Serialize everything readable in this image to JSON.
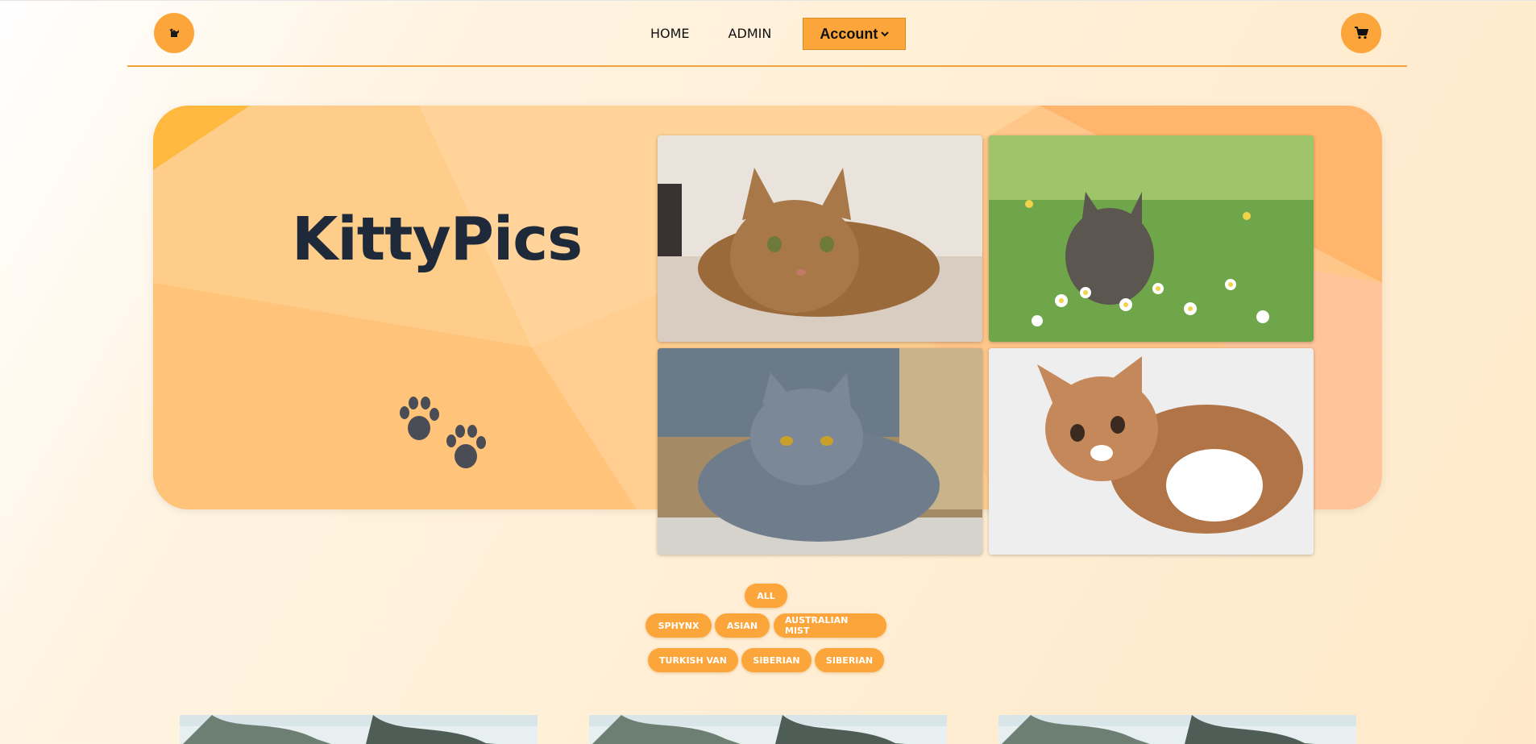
{
  "nav": {
    "logo_icon": "cat-icon",
    "links": [
      "HOME",
      "ADMIN"
    ],
    "account_label": "Account",
    "cart_icon": "cart-icon",
    "accent": "#fba53a"
  },
  "hero": {
    "title": "KittyPics",
    "decor_icon": "paw-prints-icon",
    "gallery": [
      {
        "subject": "tabby cat lying down"
      },
      {
        "subject": "kitten in daisy field"
      },
      {
        "subject": "grey british shorthair cat"
      },
      {
        "subject": "ginger kitten on blanket"
      }
    ]
  },
  "filters": {
    "all_label": "ALL",
    "row1": [
      "SPHYNX",
      "ASIAN",
      "AUSTRALIAN MIST"
    ],
    "row2": [
      "TURKISH VAN",
      "SIBERIAN",
      "SIBERIAN"
    ]
  },
  "cards": [
    {
      "image": "cat photo"
    },
    {
      "image": "cat photo"
    },
    {
      "image": "cat photo"
    }
  ]
}
